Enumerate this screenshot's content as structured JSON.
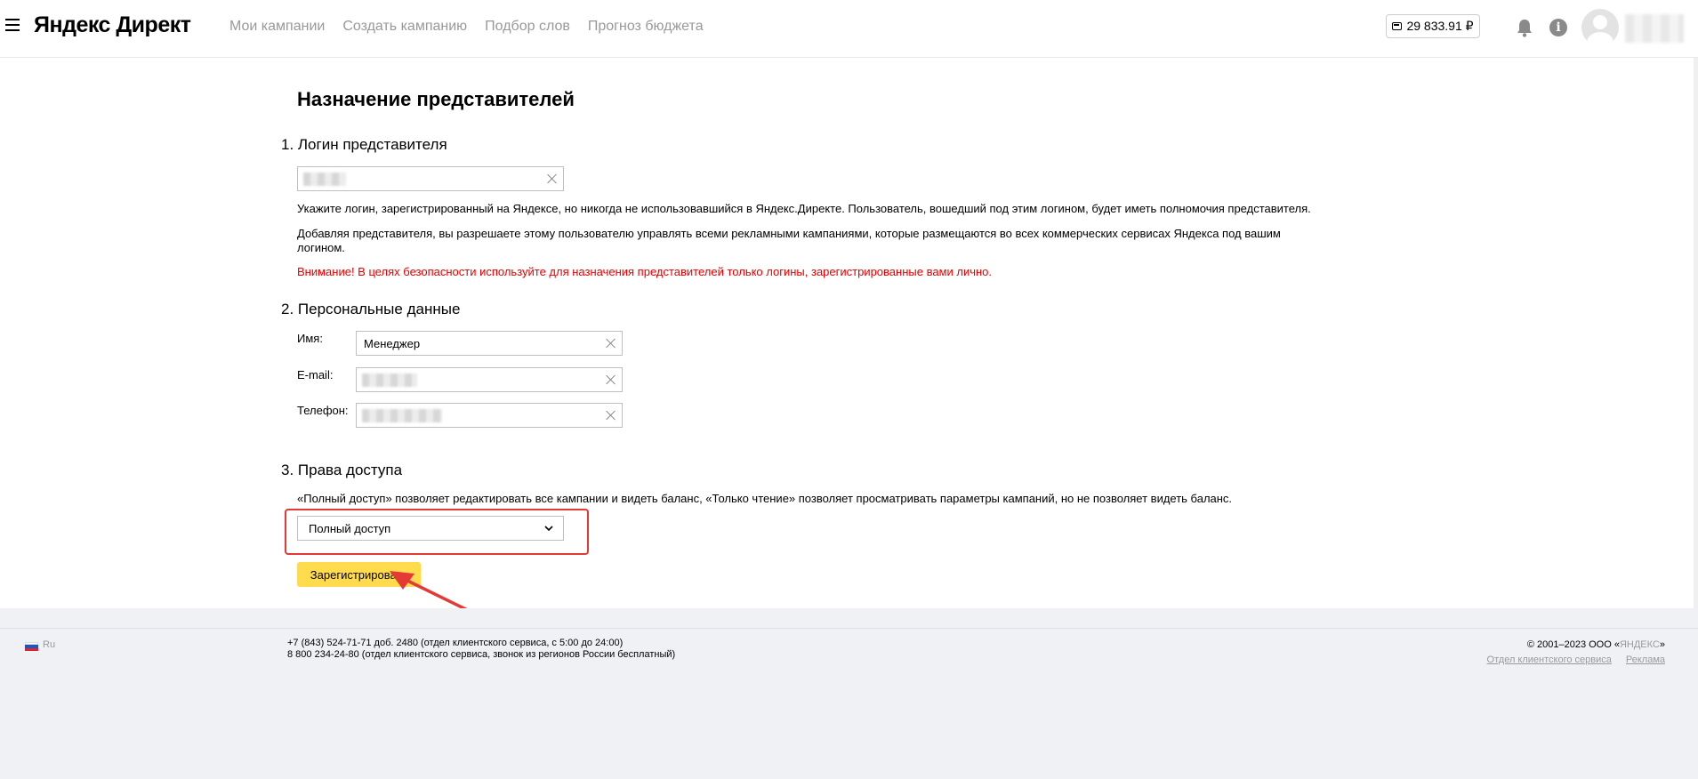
{
  "header": {
    "logo": "Яндекс Директ",
    "nav": [
      "Мои кампании",
      "Создать кампанию",
      "Подбор слов",
      "Прогноз бюджета"
    ],
    "balance": "29 833.91 ₽"
  },
  "page": {
    "title": "Назначение представителей",
    "section1": {
      "title": "1. Логин представителя",
      "hint1": "Укажите логин, зарегистрированный на Яндексе, но никогда не использовавшийся в Яндекс.Директе. Пользователь, вошедший под этим логином, будет иметь полномочия представителя.",
      "hint2": "Добавляя представителя, вы разрешаете этому пользователю управлять всеми рекламными кампаниями, которые размещаются во всех коммерческих сервисах Яндекса под вашим логином.",
      "warning": "Внимание! В целях безопасности используйте для назначения представителей только логины, зарегистрированные вами лично."
    },
    "section2": {
      "title": "2. Персональные данные",
      "name_label": "Имя:",
      "name_value": "Менеджер",
      "email_label": "E-mail:",
      "phone_label": "Телефон:"
    },
    "section3": {
      "title": "3. Права доступа",
      "hint": "«Полный доступ» позволяет редактировать все кампании и видеть баланс, «Только чтение» позволяет просматривать параметры кампаний, но не позволяет видеть баланс.",
      "selected": "Полный доступ"
    },
    "register_button": "Зарегистрировать"
  },
  "footer": {
    "lang": "Ru",
    "phone1": "+7 (843) 524-71-71 доб. 2480 (отдел клиентского сервиса, с 5:00 до 24:00)",
    "phone2": "8 800 234-24-80 (отдел клиентского сервиса, звонок из регионов России бесплатный)",
    "copyright_prefix": "© 2001–2023 ООО «",
    "copyright_link": "ЯНДЕКС",
    "copyright_suffix": "»",
    "links": [
      "Отдел клиентского сервиса",
      "Реклама"
    ]
  },
  "colors": {
    "accent_button": "#ffdb4d",
    "warning": "#e60000",
    "highlight": "#e53935"
  },
  "icons": [
    "menu-icon",
    "wallet-icon",
    "bell-icon",
    "info-icon",
    "avatar",
    "clear-icon",
    "chevron-down-icon",
    "ru-flag-icon",
    "annotation-arrow"
  ]
}
